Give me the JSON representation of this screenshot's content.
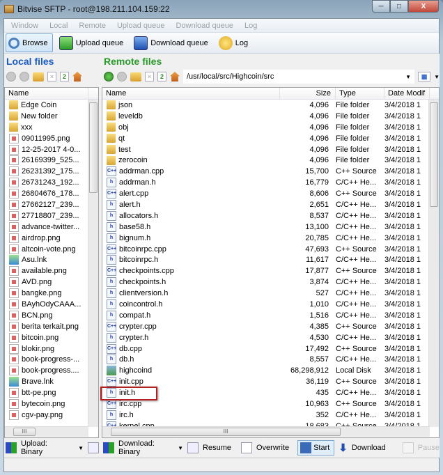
{
  "window": {
    "title": "Bitvise SFTP - root@198.211.104.159:22",
    "minimize": "─",
    "maximize": "□",
    "close": "X"
  },
  "menu": [
    "Window",
    "Local",
    "Remote",
    "Upload queue",
    "Download queue",
    "Log"
  ],
  "toolbar": [
    {
      "label": "Browse",
      "icon": "magnifier-icon",
      "active": true
    },
    {
      "label": "Upload queue",
      "icon": "upload-arrow-icon"
    },
    {
      "label": "Download queue",
      "icon": "download-arrow-icon"
    },
    {
      "label": "Log",
      "icon": "speech-bubble-icon"
    }
  ],
  "local": {
    "title": "Local files",
    "title_color": "#1a5bc4",
    "columns": [
      "Name"
    ],
    "files": [
      [
        "Edge Coin",
        "folder"
      ],
      [
        "New folder",
        "folder"
      ],
      [
        "xxx",
        "folder"
      ],
      [
        "09011995.png",
        "png"
      ],
      [
        "12-25-2017 4-0...",
        "png"
      ],
      [
        "26169399_525...",
        "png"
      ],
      [
        "26231392_175...",
        "png"
      ],
      [
        "26731243_192...",
        "png"
      ],
      [
        "26804676_178...",
        "png"
      ],
      [
        "27662127_239...",
        "png"
      ],
      [
        "27718807_239...",
        "png"
      ],
      [
        "advance-twitter...",
        "png"
      ],
      [
        "airdrop.png",
        "png"
      ],
      [
        "altcoin-vote.png",
        "png"
      ],
      [
        "Asu.lnk",
        "lnk"
      ],
      [
        "available.png",
        "png"
      ],
      [
        "AVD.png",
        "png"
      ],
      [
        "bangke.png",
        "png"
      ],
      [
        "BAyhOdyCAAA...",
        "png"
      ],
      [
        "BCN.png",
        "png"
      ],
      [
        "berita terkait.png",
        "png"
      ],
      [
        "bitcoin.png",
        "png"
      ],
      [
        "blokir.png",
        "png"
      ],
      [
        "book-progress-...",
        "png"
      ],
      [
        "book-progress....",
        "png"
      ],
      [
        "Brave.lnk",
        "lnk"
      ],
      [
        "btt-pe.png",
        "png"
      ],
      [
        "bytecoin.png",
        "png"
      ],
      [
        "cgv-pay.png",
        "png"
      ]
    ],
    "transfer_mode": "Upload: Binary"
  },
  "remote": {
    "title": "Remote files",
    "title_color": "#2a9a2a",
    "path": "/usr/local/src/Highcoin/src",
    "columns": [
      "Name",
      "Size",
      "Type",
      "Date Modif"
    ],
    "files": [
      [
        "json",
        "4,096",
        "File folder",
        "3/4/2018 1",
        "folder"
      ],
      [
        "leveldb",
        "4,096",
        "File folder",
        "3/4/2018 1",
        "folder"
      ],
      [
        "obj",
        "4,096",
        "File folder",
        "3/4/2018 1",
        "folder"
      ],
      [
        "qt",
        "4,096",
        "File folder",
        "3/4/2018 1",
        "folder"
      ],
      [
        "test",
        "4,096",
        "File folder",
        "3/4/2018 1",
        "folder"
      ],
      [
        "zerocoin",
        "4,096",
        "File folder",
        "3/4/2018 1",
        "folder"
      ],
      [
        "addrman.cpp",
        "15,700",
        "C++ Source",
        "3/4/2018 1",
        "cpp"
      ],
      [
        "addrman.h",
        "16,779",
        "C/C++ He...",
        "3/4/2018 1",
        "h"
      ],
      [
        "alert.cpp",
        "8,606",
        "C++ Source",
        "3/4/2018 1",
        "cpp"
      ],
      [
        "alert.h",
        "2,651",
        "C/C++ He...",
        "3/4/2018 1",
        "h"
      ],
      [
        "allocators.h",
        "8,537",
        "C/C++ He...",
        "3/4/2018 1",
        "h"
      ],
      [
        "base58.h",
        "13,100",
        "C/C++ He...",
        "3/4/2018 1",
        "h"
      ],
      [
        "bignum.h",
        "20,785",
        "C/C++ He...",
        "3/4/2018 1",
        "h"
      ],
      [
        "bitcoinrpc.cpp",
        "47,693",
        "C++ Source",
        "3/4/2018 1",
        "cpp"
      ],
      [
        "bitcoinrpc.h",
        "11,617",
        "C/C++ He...",
        "3/4/2018 1",
        "h"
      ],
      [
        "checkpoints.cpp",
        "17,877",
        "C++ Source",
        "3/4/2018 1",
        "cpp"
      ],
      [
        "checkpoints.h",
        "3,874",
        "C/C++ He...",
        "3/4/2018 1",
        "h"
      ],
      [
        "clientversion.h",
        "527",
        "C/C++ He...",
        "3/4/2018 1",
        "h"
      ],
      [
        "coincontrol.h",
        "1,010",
        "C/C++ He...",
        "3/4/2018 1",
        "h"
      ],
      [
        "compat.h",
        "1,516",
        "C/C++ He...",
        "3/4/2018 1",
        "h"
      ],
      [
        "crypter.cpp",
        "4,385",
        "C++ Source",
        "3/4/2018 1",
        "cpp"
      ],
      [
        "crypter.h",
        "4,530",
        "C/C++ He...",
        "3/4/2018 1",
        "h"
      ],
      [
        "db.cpp",
        "17,492",
        "C++ Source",
        "3/4/2018 1",
        "cpp"
      ],
      [
        "db.h",
        "8,557",
        "C/C++ He...",
        "3/4/2018 1",
        "h"
      ],
      [
        "highcoind",
        "68,298,912",
        "Local Disk",
        "3/4/2018 1",
        "exe"
      ],
      [
        "init.cpp",
        "36,119",
        "C++ Source",
        "3/4/2018 1",
        "cpp"
      ],
      [
        "init.h",
        "435",
        "C/C++ He...",
        "3/4/2018 1",
        "h"
      ],
      [
        "irc.cpp",
        "10,963",
        "C++ Source",
        "3/4/2018 1",
        "cpp"
      ],
      [
        "irc.h",
        "352",
        "C/C++ He...",
        "3/4/2018 1",
        "h"
      ],
      [
        "kernel.cpp",
        "18,683",
        "C++ Source",
        "3/4/2018 1",
        "cpp"
      ]
    ],
    "highlighted": "highcoind",
    "highlight_color": "#b22020",
    "transfer_mode": "Download: Binary",
    "actions": [
      "Resume",
      "Overwrite",
      "Start",
      "Download",
      "Pause"
    ]
  }
}
